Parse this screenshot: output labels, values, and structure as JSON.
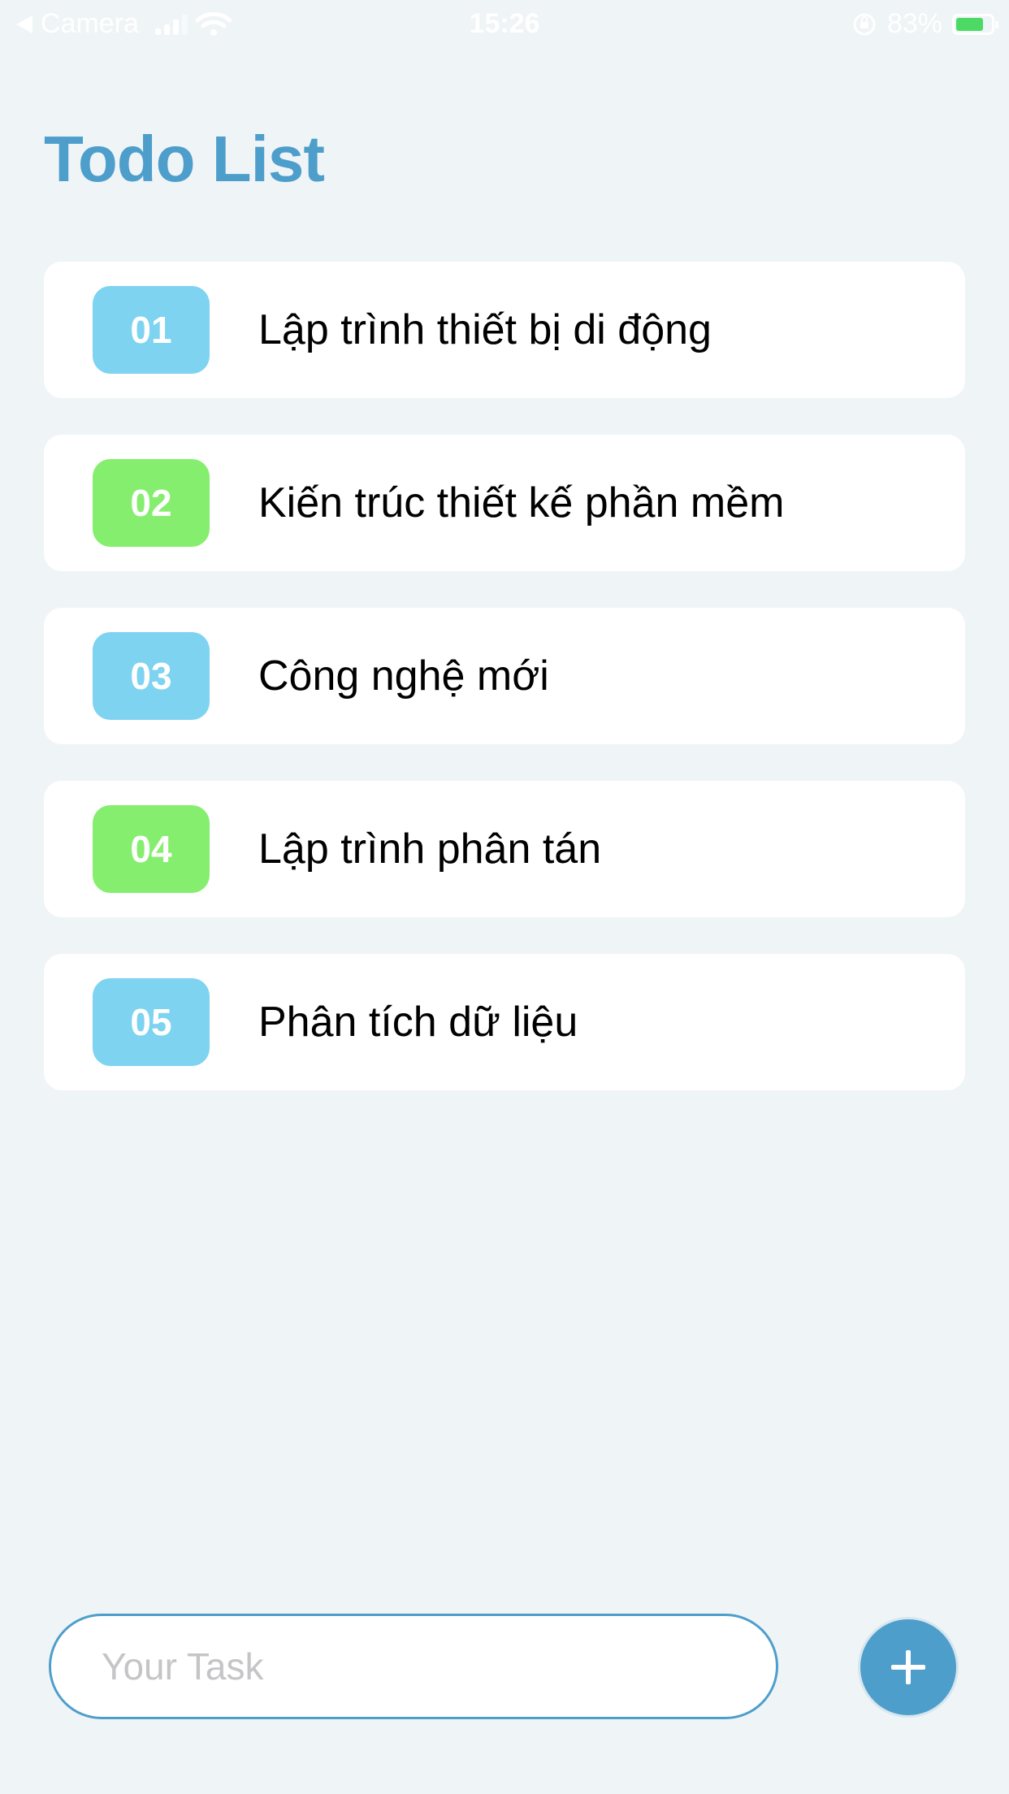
{
  "status_bar": {
    "back_app": "Camera",
    "time": "15:26",
    "battery": "83%",
    "battery_level": 0.83
  },
  "header": {
    "title": "Todo List"
  },
  "tasks": [
    {
      "number": "01",
      "label": "Lập trình thiết bị di động",
      "badge_color": "#7dd3f0"
    },
    {
      "number": "02",
      "label": "Kiến trúc thiết kế phần mềm",
      "badge_color": "#86ee6e"
    },
    {
      "number": "03",
      "label": "Công nghệ mới",
      "badge_color": "#7dd3f0"
    },
    {
      "number": "04",
      "label": "Lập trình phân tán",
      "badge_color": "#86ee6e"
    },
    {
      "number": "05",
      "label": "Phân tích dữ liệu",
      "badge_color": "#7dd3f0"
    }
  ],
  "input": {
    "placeholder": "Your Task",
    "value": ""
  },
  "colors": {
    "accent": "#4e9ecb",
    "background": "#eff4f7"
  }
}
